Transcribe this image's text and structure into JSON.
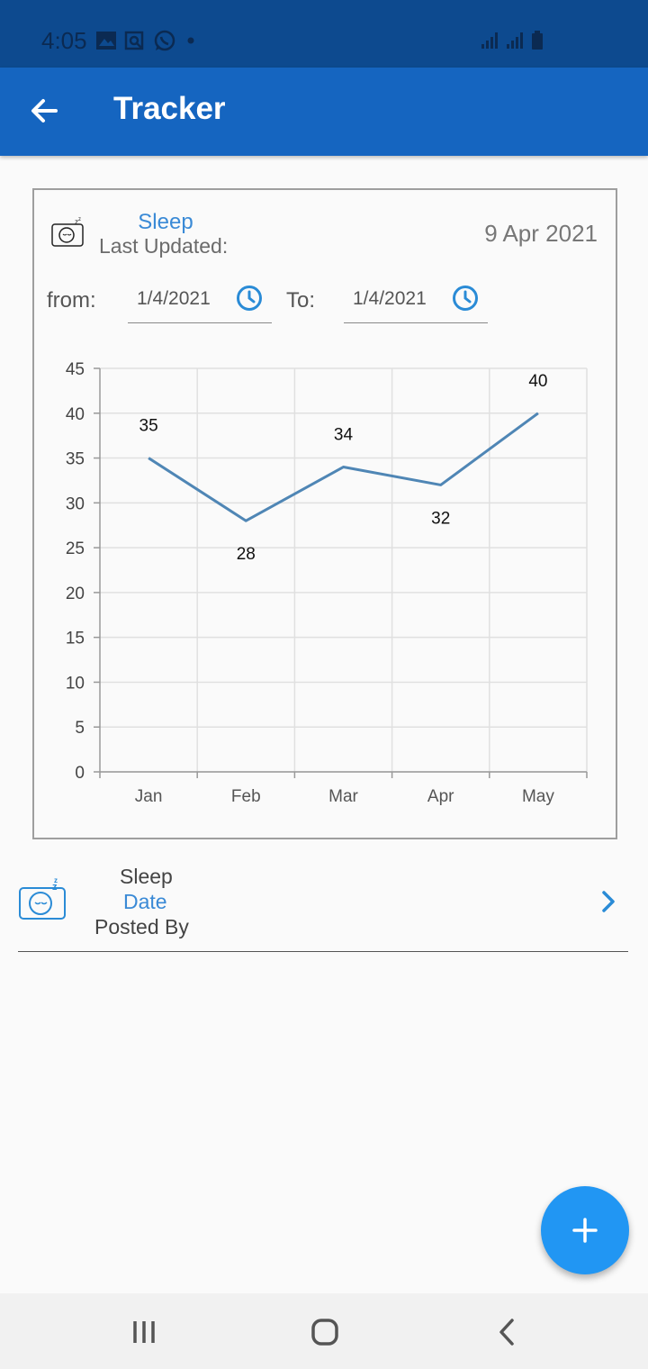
{
  "status_bar": {
    "time": "4:05",
    "icons_left": [
      "image-icon",
      "screen-search-icon",
      "whatsapp-icon",
      "dot-icon"
    ],
    "icons_right": [
      "signal-icon",
      "signal-icon",
      "battery-icon"
    ]
  },
  "app_bar": {
    "title": "Tracker",
    "back_icon": "arrow-left-icon"
  },
  "card": {
    "title": "Sleep",
    "subtitle": "Last Updated:",
    "date": "9 Apr 2021",
    "icon": "sleep-icon",
    "from_label": "from:",
    "from_value": "1/4/2021",
    "to_label": "To:",
    "to_value": "1/4/2021",
    "clock_icon": "clock-icon"
  },
  "chart_data": {
    "type": "line",
    "categories": [
      "Jan",
      "Feb",
      "Mar",
      "Apr",
      "May"
    ],
    "values": [
      35,
      28,
      34,
      32,
      40
    ],
    "data_labels": [
      "35",
      "28",
      "34",
      "32",
      "40"
    ],
    "y_ticks": [
      "0",
      "5",
      "10",
      "15",
      "20",
      "25",
      "30",
      "35",
      "40",
      "45"
    ],
    "ylim": [
      0,
      45
    ],
    "grid": true,
    "line_color": "#4f86b5"
  },
  "list": {
    "items": [
      {
        "title": "Sleep",
        "date": "Date",
        "posted_by": "Posted By",
        "icon": "sleep-icon",
        "chevron": "chevron-right-icon"
      }
    ]
  },
  "fab": {
    "icon": "plus-icon"
  },
  "nav_bar": {
    "icons": [
      "recent-apps-icon",
      "home-icon",
      "back-icon"
    ]
  },
  "colors": {
    "status_bar": "#0d4a8f",
    "app_bar": "#1565c0",
    "accent": "#3a8ad6",
    "fab": "#2196f3"
  }
}
